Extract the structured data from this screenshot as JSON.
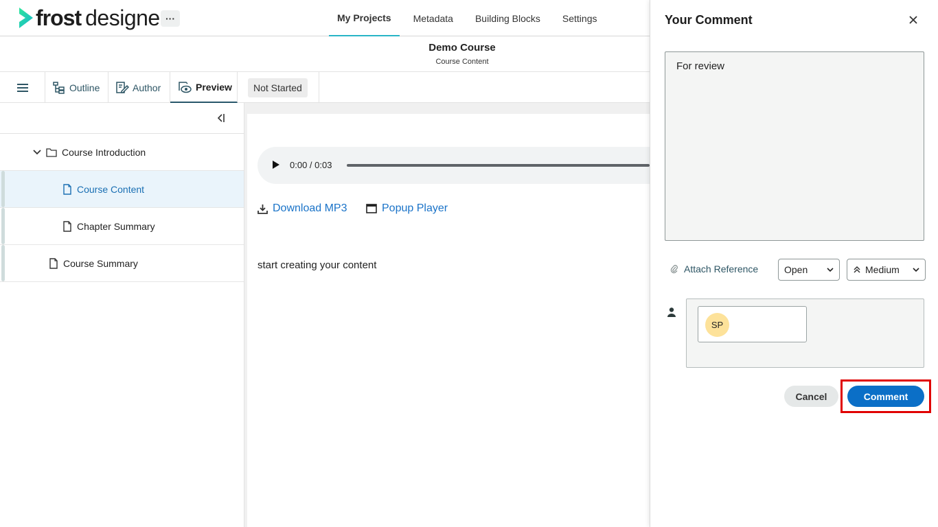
{
  "app": {
    "logo_bold": "frost",
    "logo_light": "designer",
    "more_label": "···"
  },
  "topnav": [
    {
      "label": "My Projects",
      "active": true
    },
    {
      "label": "Metadata",
      "active": false
    },
    {
      "label": "Building Blocks",
      "active": false
    },
    {
      "label": "Settings",
      "active": false
    }
  ],
  "course": {
    "title": "Demo Course",
    "subtitle": "Course Content"
  },
  "toolbar": {
    "tabs": [
      {
        "label": "Outline",
        "icon": "outline-icon"
      },
      {
        "label": "Author",
        "icon": "author-icon"
      },
      {
        "label": "Preview",
        "icon": "preview-icon",
        "active": true
      }
    ],
    "status": "Not Started"
  },
  "tree": [
    {
      "label": "Course Introduction",
      "type": "folder",
      "expanded": true
    },
    {
      "label": "Course Content",
      "type": "page",
      "selected": true
    },
    {
      "label": "Chapter Summary",
      "type": "page"
    },
    {
      "label": "Course Summary",
      "type": "page"
    }
  ],
  "player": {
    "time": "0:00 / 0:03"
  },
  "links": {
    "download": "Download MP3",
    "popup": "Popup Player"
  },
  "content": {
    "text": "start creating your content"
  },
  "comment_panel": {
    "title": "Your Comment",
    "text": "For review",
    "attach_label": "Attach Reference",
    "status_value": "Open",
    "priority_value": "Medium",
    "assignee_initials": "SP",
    "cancel_label": "Cancel",
    "submit_label": "Comment"
  },
  "colors": {
    "accent": "#28b5c6",
    "link": "#1a73c8",
    "primary_button": "#0b6fc7",
    "highlight": "#e00000"
  }
}
